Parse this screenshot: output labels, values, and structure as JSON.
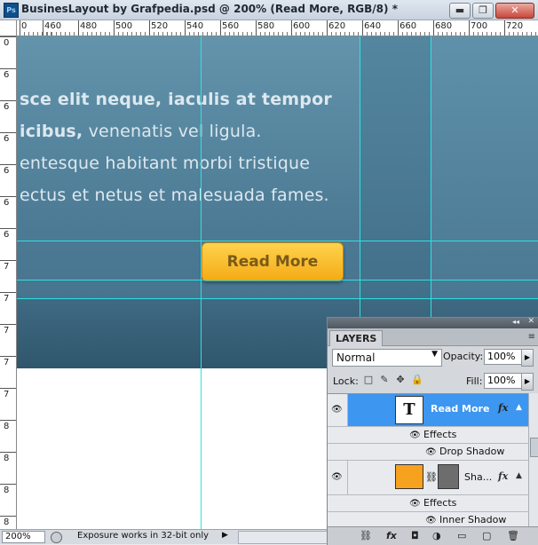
{
  "window": {
    "title": "BusinesLayout by Grafpedia.psd @ 200% (Read More, RGB/8) *",
    "app_icon": "Ps",
    "controls": [
      "▬",
      "❐",
      "✕"
    ]
  },
  "rulers": {
    "h_labels": [
      "0",
      "460",
      "480",
      "500",
      "520",
      "540",
      "560",
      "580",
      "600",
      "620",
      "640",
      "660",
      "680",
      "700",
      "720"
    ],
    "v_labels": [
      "0",
      "6",
      "6",
      "6",
      "6",
      "6",
      "6",
      "7",
      "7",
      "7",
      "7",
      "7",
      "8",
      "8",
      "8",
      "8"
    ]
  },
  "canvas": {
    "text_lines": [
      "sce elit neque, iaculis at tempor",
      "icibus, venenatis vel ligula.",
      "entesque habitant morbi tristique",
      "ectus et netus et malesuada fames."
    ],
    "text_bold_part": "icibus,",
    "text_regular_part": " venenatis vel ligula.",
    "button_label": "Read More"
  },
  "status": {
    "zoom": "200%",
    "message": "Exposure works in 32-bit only"
  },
  "layers_panel": {
    "tab": "LAYERS",
    "top_arrows": "◂◂",
    "top_close": "✕",
    "menu_icon": "≡",
    "blend_mode": "Normal",
    "opacity_label": "Opacity:",
    "opacity_value": "100%",
    "lock_label": "Lock:",
    "lock_icons": [
      "□",
      "✎",
      "✥",
      "🔒"
    ],
    "fill_label": "Fill:",
    "fill_value": "100%",
    "layers": [
      {
        "name": "Read More",
        "thumb": "T",
        "fx": "fx",
        "selected": true
      },
      {
        "effects_label": "Effects",
        "effect": "Drop Shadow"
      },
      {
        "name": "Sha...",
        "fx": "fx"
      },
      {
        "effects_label": "Effects",
        "effect": "Inner Shadow"
      }
    ],
    "bottom_icons": [
      "⛓",
      "fx",
      "◘",
      "◑",
      "▭",
      "▢",
      "🗑"
    ]
  }
}
